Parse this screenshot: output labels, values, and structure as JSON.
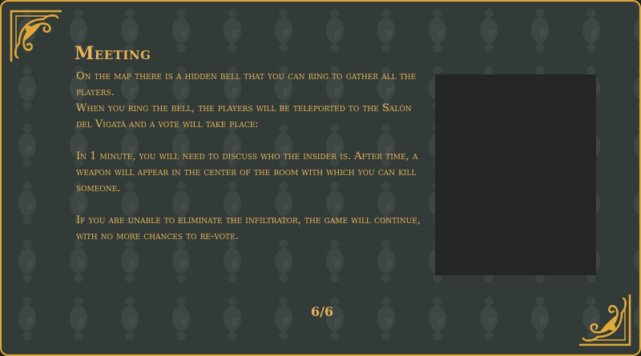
{
  "dialog": {
    "title": "Meeting",
    "paragraphs": [
      "On the map there is a hidden bell that you can ring to gather all the players.",
      "When you ring the bell, the players will be teleported to the Salón del Vigatà and a vote will take place:",
      "In 1 minute, you will need to discuss who the insider is. After time, a weapon will appear in the center of the room with which you can kill someone.",
      "If you are unable to eliminate the infiltrator, the game will continue, with no more chances to re-vote."
    ],
    "page_indicator": "6/6"
  },
  "colors": {
    "accent_gold": "#e0a93a",
    "text_gold": "#e8b25a",
    "background_green": "#323b37",
    "media_box": "#242726"
  },
  "icons": {
    "top_left": "ornament-corner-icon",
    "bottom_right": "ornament-corner-icon"
  }
}
